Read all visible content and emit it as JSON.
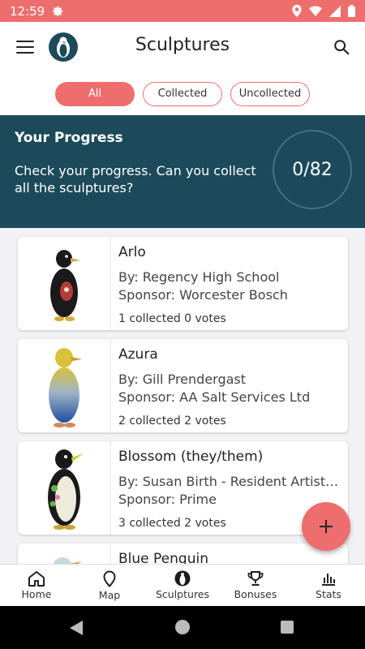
{
  "status": {
    "time": "12:59"
  },
  "header": {
    "title": "Sculptures"
  },
  "filters": {
    "all": "All",
    "collected": "Collected",
    "uncollected": "Uncollected"
  },
  "progress": {
    "title": "Your Progress",
    "description": "Check your progress. Can you collect all the sculptures?",
    "count": "0/82"
  },
  "sculptures": [
    {
      "name": "Arlo",
      "by": "By: Regency High School",
      "sponsor": "Sponsor: Worcester Bosch",
      "stats": "1 collected 0 votes"
    },
    {
      "name": "Azura",
      "by": "By: Gill Prendergast",
      "sponsor": "Sponsor: AA Salt Services Ltd",
      "stats": "2 collected 2 votes"
    },
    {
      "name": "Blossom (they/them)",
      "by": "By: Susan Birth - Resident Artist at Warley Woods",
      "sponsor": "Sponsor: Prime",
      "stats": "3 collected 2 votes"
    },
    {
      "name": "Blue Penguin",
      "by": "",
      "sponsor": "",
      "stats": ""
    }
  ],
  "nav": {
    "home": "Home",
    "map": "Map",
    "sculptures": "Sculptures",
    "bonuses": "Bonuses",
    "stats": "Stats"
  },
  "colors": {
    "accent": "#ee6e6e",
    "primary": "#1c4a5a"
  }
}
